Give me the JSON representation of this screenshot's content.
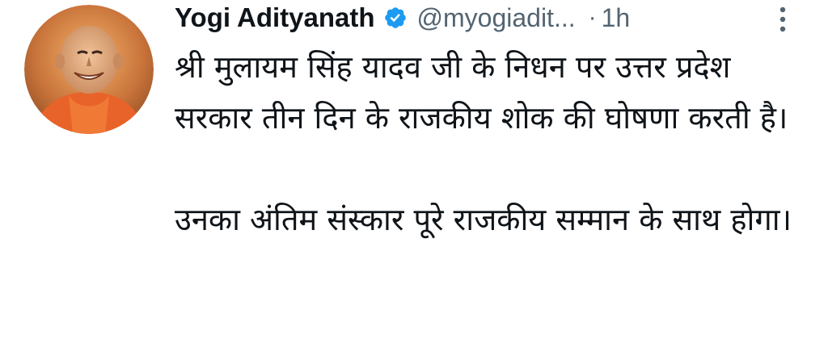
{
  "tweet": {
    "author_name": "Yogi Adityanath",
    "handle": "@myogiadit...",
    "separator": "·",
    "time": "1h",
    "verified_icon": "verified-badge-icon",
    "more_icon": "more-vertical-icon",
    "paragraph_1": "श्री मुलायम सिंह यादव जी के निधन पर उत्तर प्रदेश सरकार तीन दिन के राजकीय शोक की घोषणा करती है।",
    "paragraph_2": "उनका अंतिम संस्कार पूरे राजकीय सम्मान के साथ होगा।"
  },
  "colors": {
    "text": "#0f1419",
    "secondary": "#536471",
    "verified_blue": "#1d9bf0",
    "saffron": "#e8632a"
  }
}
